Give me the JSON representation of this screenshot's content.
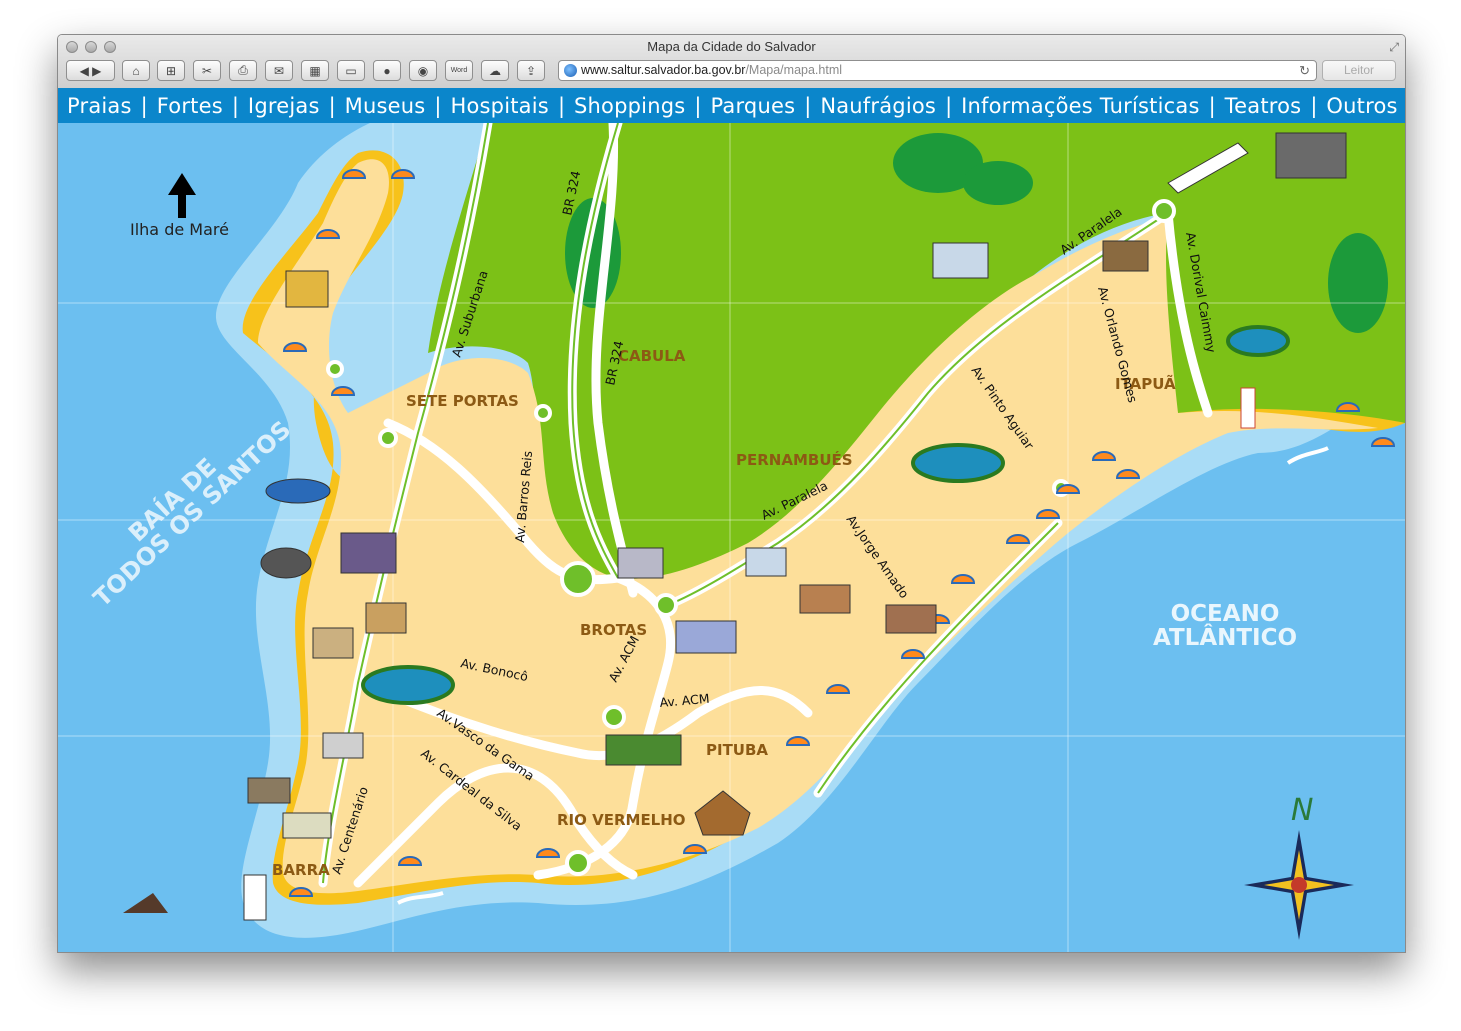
{
  "window": {
    "title": "Mapa da Cidade do Salvador"
  },
  "toolbar": {
    "buttons": [
      "back-forward",
      "home",
      "add-bookmark",
      "cut",
      "print",
      "mail",
      "grid",
      "bag",
      "record",
      "record2",
      "word",
      "cloud",
      "share"
    ],
    "word_label": "Word",
    "url_host": "www.saltur.salvador.ba.gov.br",
    "url_path": "/Mapa/mapa.html",
    "reader_label": "Leitor"
  },
  "menu": {
    "items": [
      "Praias",
      "Fortes",
      "Igrejas",
      "Museus",
      "Hospitais",
      "Shoppings",
      "Parques",
      "Naufrágios",
      "Informações Turísticas",
      "Teatros",
      "Outros"
    ],
    "separator": "|"
  },
  "map": {
    "labels": {
      "ilha": "Ilha de Maré",
      "baia_1": "BAÍA DE",
      "baia_2": "TODOS OS SANTOS",
      "oceano_1": "OCEANO",
      "oceano_2": "ATLÂNTICO",
      "sete_portas": "SETE PORTAS",
      "cabula": "CABULA",
      "pernambues": "PERNAMBUÉS",
      "itapua": "ITAPUÃ",
      "brotas": "BROTAS",
      "pituba": "PITUBA",
      "rio_vermelho": "RIO VERMELHO",
      "barra": "BARRA"
    },
    "streets": {
      "suburbana": "Av. Suburbana",
      "br324_a": "BR 324",
      "br324_b": "BR 324",
      "barros_reis": "Av. Barros Reis",
      "paralela_1": "Av. Paralela",
      "paralela_2": "Av. Paralela",
      "dorival": "Av. Dorival Caimmy",
      "orlando": "Av. Orlando Gomes",
      "pinto": "Av. Pinto Aguiar",
      "jorge": "Av.Jorge Amado",
      "bonoco": "Av. Bonocô",
      "acm_1": "Av. ACM",
      "acm_2": "Av. ACM",
      "vasco": "Av.Vasco da Gama",
      "cardeal": "Av. Cardeal da Silva",
      "centenario": "Av. Centenário"
    },
    "compass_letter": "N",
    "colors": {
      "sea": "#6cbff0",
      "shallow": "#a9dcf6",
      "land": "#fddf9a",
      "sand": "#f7c21b",
      "green": "#7cc117",
      "road": "#ffffff"
    }
  }
}
